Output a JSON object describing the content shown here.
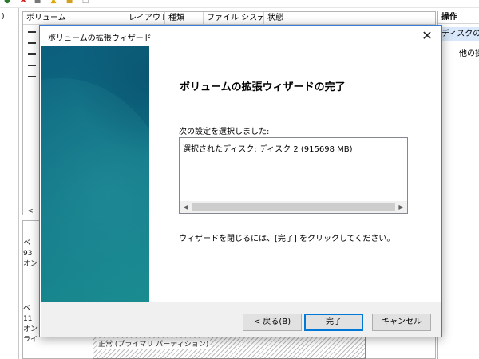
{
  "background": {
    "left_strip_text": ")",
    "columns": [
      "ボリューム",
      "レイアウト",
      "種類",
      "ファイル システム",
      "状態"
    ],
    "scroll_left_arrow": "<",
    "disk1_label": [
      "ベ",
      "93",
      "オン"
    ],
    "disk2_label": [
      "ベ",
      "11",
      "オンライ"
    ],
    "partition_text": "正常 (プライマリ パーティション)",
    "ops_header": "操作",
    "ops_selected": "ディスクの管",
    "ops_other": "他の操"
  },
  "dialog": {
    "title": "ボリュームの拡張ウィザード",
    "close_glyph": "✕",
    "heading": "ボリュームの拡張ウィザードの完了",
    "settings_label": "次の設定を選択しました:",
    "settings_text": "選択されたディスク: ディスク 2 (915698 MB)",
    "scroll_left": "◀",
    "scroll_right": "▶",
    "finish_hint": "ウィザードを閉じるには、[完了] をクリックしてください。",
    "buttons": {
      "back": "< 戻る(B)",
      "finish": "完了",
      "cancel": "キャンセル"
    }
  },
  "colors": {
    "accent": "#0078d7",
    "side_panel": "#0e6e82",
    "selection": "#d9e8fa"
  }
}
